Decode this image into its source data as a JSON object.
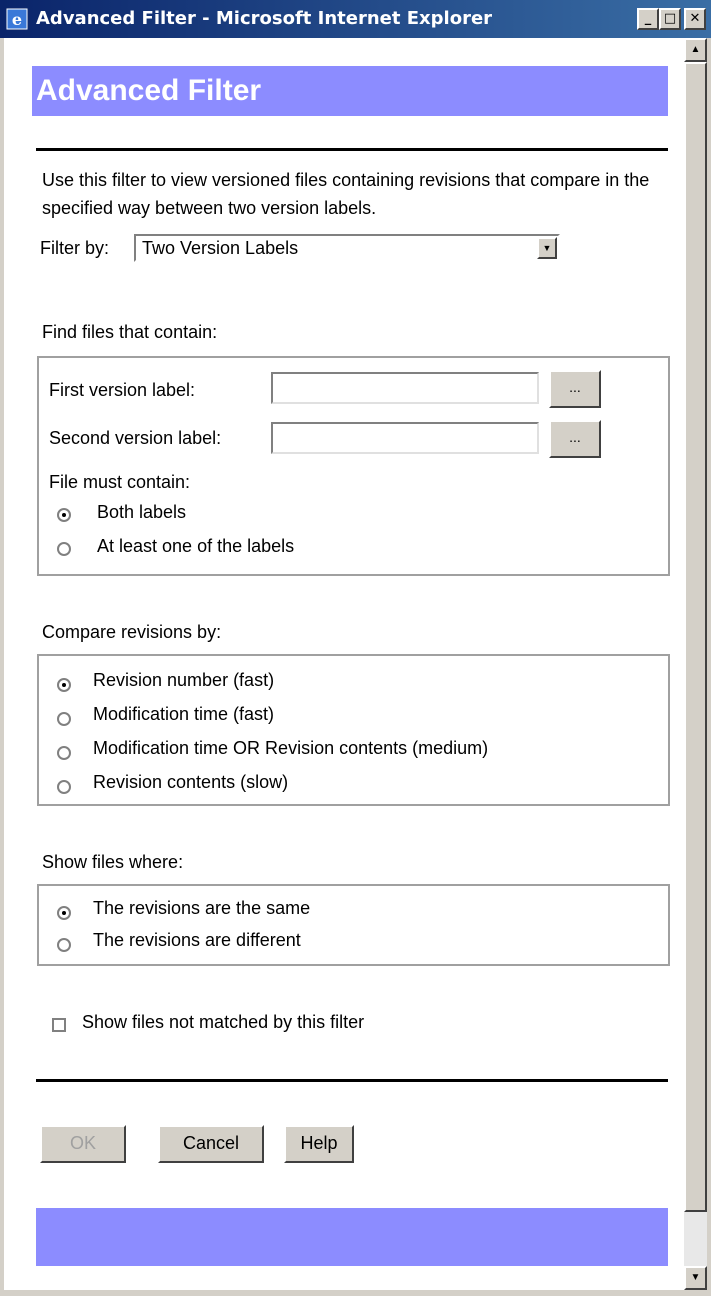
{
  "window": {
    "title": "Advanced Filter - Microsoft Internet Explorer",
    "min": "_",
    "max": "□",
    "close": "✕"
  },
  "page": {
    "heading": "Advanced Filter",
    "description": "Use this filter to view versioned files containing revisions that compare in the specified way between two version labels.",
    "filter_by_label": "Filter by:",
    "filter_by_value": "Two Version Labels"
  },
  "find_files": {
    "title": "Find files that contain:",
    "first_label": "First version label:",
    "first_value": "",
    "second_label": "Second version label:",
    "second_value": "",
    "browse": "...",
    "must_contain_label": "File must contain:",
    "options": [
      "Both labels",
      "At least one of the labels"
    ],
    "selected": 0
  },
  "compare": {
    "title": "Compare revisions by:",
    "options": [
      "Revision number (fast)",
      "Modification time (fast)",
      "Modification time OR Revision contents (medium)",
      "Revision contents (slow)"
    ],
    "selected": 0
  },
  "show_files": {
    "title": "Show files where:",
    "options": [
      "The revisions are the same",
      "The revisions are different"
    ],
    "selected": 0
  },
  "checkbox": {
    "label": "Show files not matched by this filter",
    "checked": false
  },
  "buttons": {
    "ok": "OK",
    "cancel": "Cancel",
    "help": "Help"
  },
  "colors": {
    "banner": "#8c8cff",
    "titlebar_start": "#0a246a",
    "titlebar_end": "#3a6ea5"
  }
}
